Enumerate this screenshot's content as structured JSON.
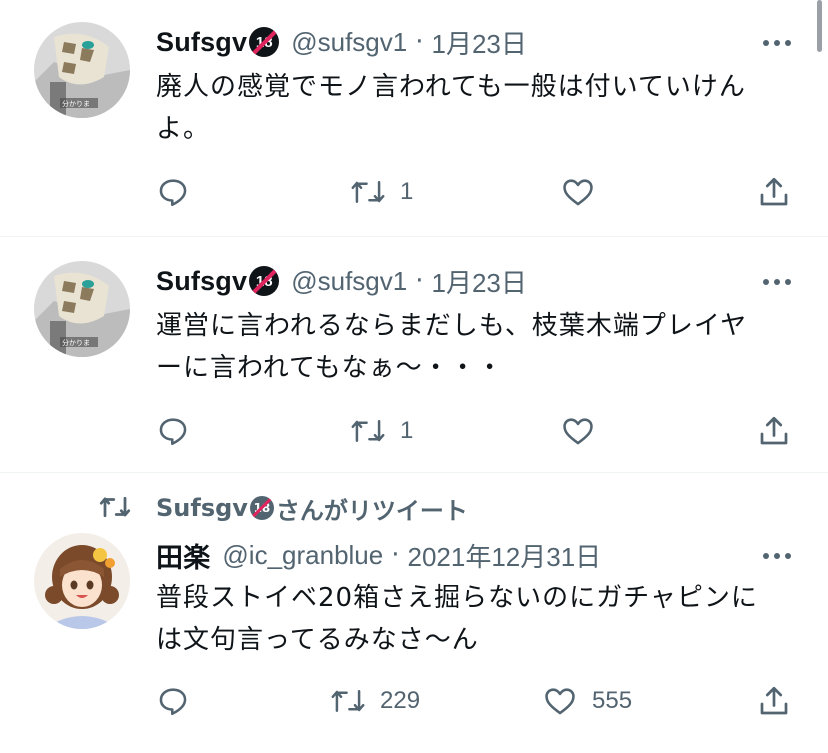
{
  "tweets": [
    {
      "name": "Sufsgv",
      "badge": "18",
      "handle": "@sufsgv1",
      "separator": "·",
      "date": "1月23日",
      "text_line1": "廃人の感覚でモノ言われても一般は付いていけん",
      "text_line2": "よ。",
      "retweets": "1",
      "likes": "",
      "avatar_caption": "分かりま",
      "icons": [
        "reply-icon",
        "retweet-icon",
        "like-icon",
        "share-icon"
      ]
    },
    {
      "name": "Sufsgv",
      "badge": "18",
      "handle": "@sufsgv1",
      "separator": "·",
      "date": "1月23日",
      "text_line1": "運営に言われるならまだしも、枝葉木端プレイヤ",
      "text_line2": "ーに言われてもなぁ〜・・・",
      "retweets": "1",
      "likes": "",
      "avatar_caption": "分かりま",
      "icons": [
        "reply-icon",
        "retweet-icon",
        "like-icon",
        "share-icon"
      ]
    },
    {
      "retweeted_by_name": "Sufsgv",
      "retweeted_by_badge": "18",
      "retweeted_suffix": "さんがリツイート",
      "name": "田楽",
      "handle": "@ic_granblue",
      "separator": "·",
      "date": "2021年12月31日",
      "text_line1": "普段ストイベ20箱さえ掘らないのにガチャピンに",
      "text_line2": "は文句言ってるみなさ〜ん",
      "retweets": "229",
      "likes": "555",
      "icons": [
        "reply-icon",
        "retweet-icon",
        "like-icon",
        "share-icon"
      ]
    }
  ],
  "colors": {
    "text": "#0f1419",
    "secondary": "#536471",
    "divider": "#eff3f4",
    "badge_slash": "#e0245e"
  }
}
